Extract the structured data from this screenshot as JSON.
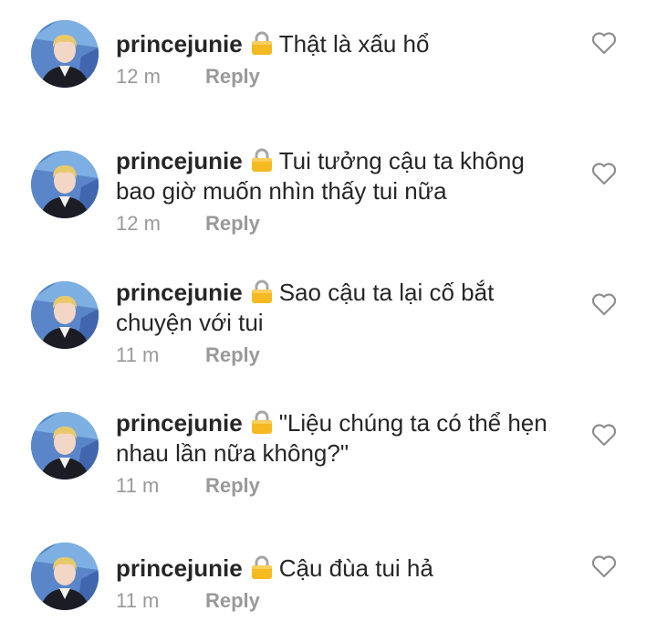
{
  "comments": [
    {
      "username": "princejunie",
      "text": "Thật là xấu hổ",
      "time": "12 m",
      "reply_label": "Reply"
    },
    {
      "username": "princejunie",
      "text": "Tui tưởng cậu ta không bao giờ muốn nhìn thấy tui nữa",
      "time": "12 m",
      "reply_label": "Reply"
    },
    {
      "username": "princejunie",
      "text": "Sao cậu ta lại cố bắt chuyện với tui",
      "time": "11 m",
      "reply_label": "Reply"
    },
    {
      "username": "princejunie",
      "text": "\"Liệu chúng ta có thể hẹn nhau lần nữa không?\"",
      "time": "11 m",
      "reply_label": "Reply"
    },
    {
      "username": "princejunie",
      "text": "Cậu đùa tui hả",
      "time": "11 m",
      "reply_label": "Reply"
    }
  ],
  "icons": {
    "lock": "lock-icon",
    "like": "heart-outline-icon"
  },
  "colors": {
    "text": "#262626",
    "meta": "#999999",
    "lock": "#f5b921"
  }
}
